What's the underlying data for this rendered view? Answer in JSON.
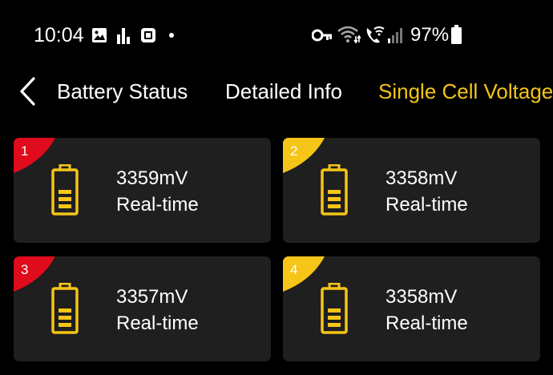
{
  "status_bar": {
    "time": "10:04",
    "battery_percent": "97%",
    "icons": [
      "image-icon",
      "bar-chart-icon",
      "square-app-icon",
      "dot-icon",
      "key-icon",
      "wifi-icon",
      "wifi-calling-icon",
      "signal-icon",
      "battery-icon"
    ]
  },
  "nav": {
    "back_icon": "chevron-left-icon",
    "tabs": [
      {
        "label": "Battery Status",
        "active": false
      },
      {
        "label": "Detailed Info",
        "active": false
      },
      {
        "label": "Single Cell Voltage",
        "active": true
      }
    ]
  },
  "colors": {
    "accent": "#f5c518",
    "red_badge": "#e00b1c",
    "card_bg": "#1f1f1f"
  },
  "cells": [
    {
      "number": "1",
      "voltage": "3359mV",
      "label": "Real-time",
      "badge_color": "#e00b1c"
    },
    {
      "number": "2",
      "voltage": "3358mV",
      "label": "Real-time",
      "badge_color": "#f5c518"
    },
    {
      "number": "3",
      "voltage": "3357mV",
      "label": "Real-time",
      "badge_color": "#e00b1c"
    },
    {
      "number": "4",
      "voltage": "3358mV",
      "label": "Real-time",
      "badge_color": "#f5c518"
    }
  ]
}
